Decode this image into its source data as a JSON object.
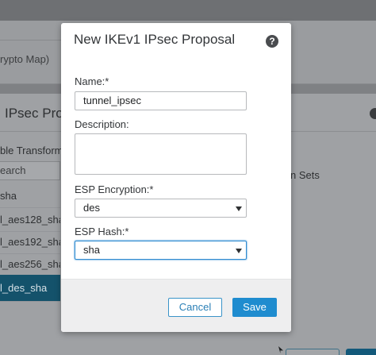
{
  "background": {
    "crypto_map_text": "rypto Map)",
    "ipsec_title": "IPsec Pro",
    "transform_label": "ble Transform",
    "search_text": "earch",
    "list_items": [
      "sha",
      "l_aes128_sha",
      "l_aes192_sha",
      "l_aes256_sha",
      "l_des_sha"
    ],
    "selected_index": 4,
    "sets_text": "n Sets"
  },
  "modal": {
    "title": "New IKEv1 IPsec Proposal",
    "help_icon": "question-circle-icon",
    "help_glyph": "?",
    "name_label": "Name:*",
    "name_value": "tunnel_ipsec",
    "description_label": "Description:",
    "description_value": "",
    "esp_encryption_label": "ESP Encryption:*",
    "esp_encryption_value": "des",
    "esp_hash_label": "ESP Hash:*",
    "esp_hash_value": "sha",
    "cancel_label": "Cancel",
    "save_label": "Save"
  },
  "colors": {
    "accent": "#1f8ccf",
    "selected_row": "#14526b"
  }
}
